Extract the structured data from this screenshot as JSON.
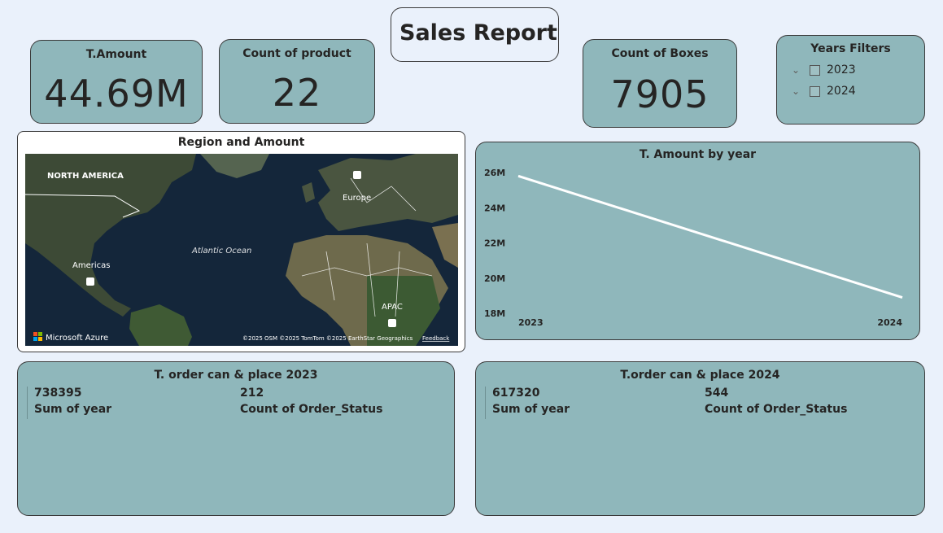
{
  "report": {
    "title": "Sales Report"
  },
  "kpis": {
    "amount": {
      "label": "T.Amount",
      "value": "44.69M"
    },
    "products": {
      "label": "Count of product",
      "value": "22"
    },
    "boxes": {
      "label": "Count of Boxes",
      "value": "7905"
    }
  },
  "filters": {
    "title": "Years Filters",
    "options": [
      {
        "label": "2023",
        "checked": false
      },
      {
        "label": "2024",
        "checked": false
      }
    ]
  },
  "map": {
    "title": "Region and Amount",
    "labels": {
      "north_america": "NORTH AMERICA",
      "europe": "Europe",
      "ocean": "Atlantic Ocean",
      "americas": "Americas",
      "apac": "APAC"
    },
    "brand": "Microsoft Azure",
    "attribution": "©2025 OSM  ©2025 TomTom  ©2025 EarthStar Geographics",
    "feedback": "Feedback"
  },
  "chart": {
    "title": "T. Amount by year",
    "yticks": [
      "26M",
      "24M",
      "22M",
      "20M",
      "18M"
    ],
    "line_color": "#ffffff"
  },
  "chart_data": {
    "type": "line",
    "title": "T. Amount by year",
    "x": [
      "2023",
      "2024"
    ],
    "series": [
      {
        "values": [
          25.8,
          18.9
        ]
      }
    ],
    "ylim": [
      18,
      26
    ],
    "yticks": [
      18,
      20,
      22,
      24,
      26
    ],
    "unit": "M",
    "grid": false
  },
  "tables": [
    {
      "title": "T. order can & place 2023",
      "col1": {
        "value": "738395",
        "label": "Sum of year"
      },
      "col2": {
        "value": "212",
        "label": "Count of Order_Status"
      }
    },
    {
      "title": "T.order can & place 2024",
      "col1": {
        "value": "617320",
        "label": "Sum of year"
      },
      "col2": {
        "value": "544",
        "label": "Count of Order_Status"
      }
    }
  ],
  "colors": {
    "card": "#8fb7bb",
    "background": "#eaf1fb",
    "border": "#3a3a3a"
  }
}
